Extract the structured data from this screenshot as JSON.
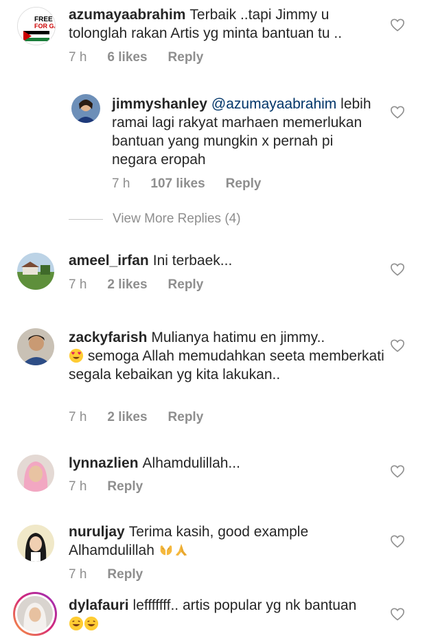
{
  "comments": [
    {
      "username": "azumayaabrahim",
      "text": "Terbaik ..tapi Jimmy u tolonglah rakan Artis yg minta bantuan tu ..",
      "time": "7 h",
      "likes": "6 likes",
      "reply": "Reply",
      "avatar_text": [
        "FREE",
        "FOR GA"
      ]
    },
    {
      "username": "jimmyshanley",
      "mention": "@azumayaabrahim",
      "text": "lebih ramai lagi rakyat marhaen memerlukan bantuan yang mungkin x pernah pi negara eropah",
      "time": "7 h",
      "likes": "107 likes",
      "reply": "Reply"
    },
    {
      "username": "ameel_irfan",
      "text": "Ini terbaek...",
      "time": "7 h",
      "likes": "2 likes",
      "reply": "Reply"
    },
    {
      "username": "zackyfarish",
      "text": "Mulianya hatimu en jimmy..",
      "text2": "semoga Allah memudahkan seeta memberkati segala kebaikan yg kita lakukan..",
      "time": "7 h",
      "likes": "2 likes",
      "reply": "Reply"
    },
    {
      "username": "lynnazlien",
      "text": "Alhamdulillah...",
      "time": "7 h",
      "reply": "Reply"
    },
    {
      "username": "nuruljay",
      "text": "Terima kasih, good example Alhamdulillah",
      "time": "7 h",
      "reply": "Reply"
    },
    {
      "username": "dylafauri",
      "text": "lefffffff.. artis popular yg nk bantuan",
      "time": "",
      "reply": ""
    }
  ],
  "view_more": "View More Replies (4)",
  "icons": {
    "like": "heart-outline-icon"
  },
  "colors": {
    "text": "#262626",
    "meta": "#8e8e8e",
    "mention": "#003569"
  }
}
